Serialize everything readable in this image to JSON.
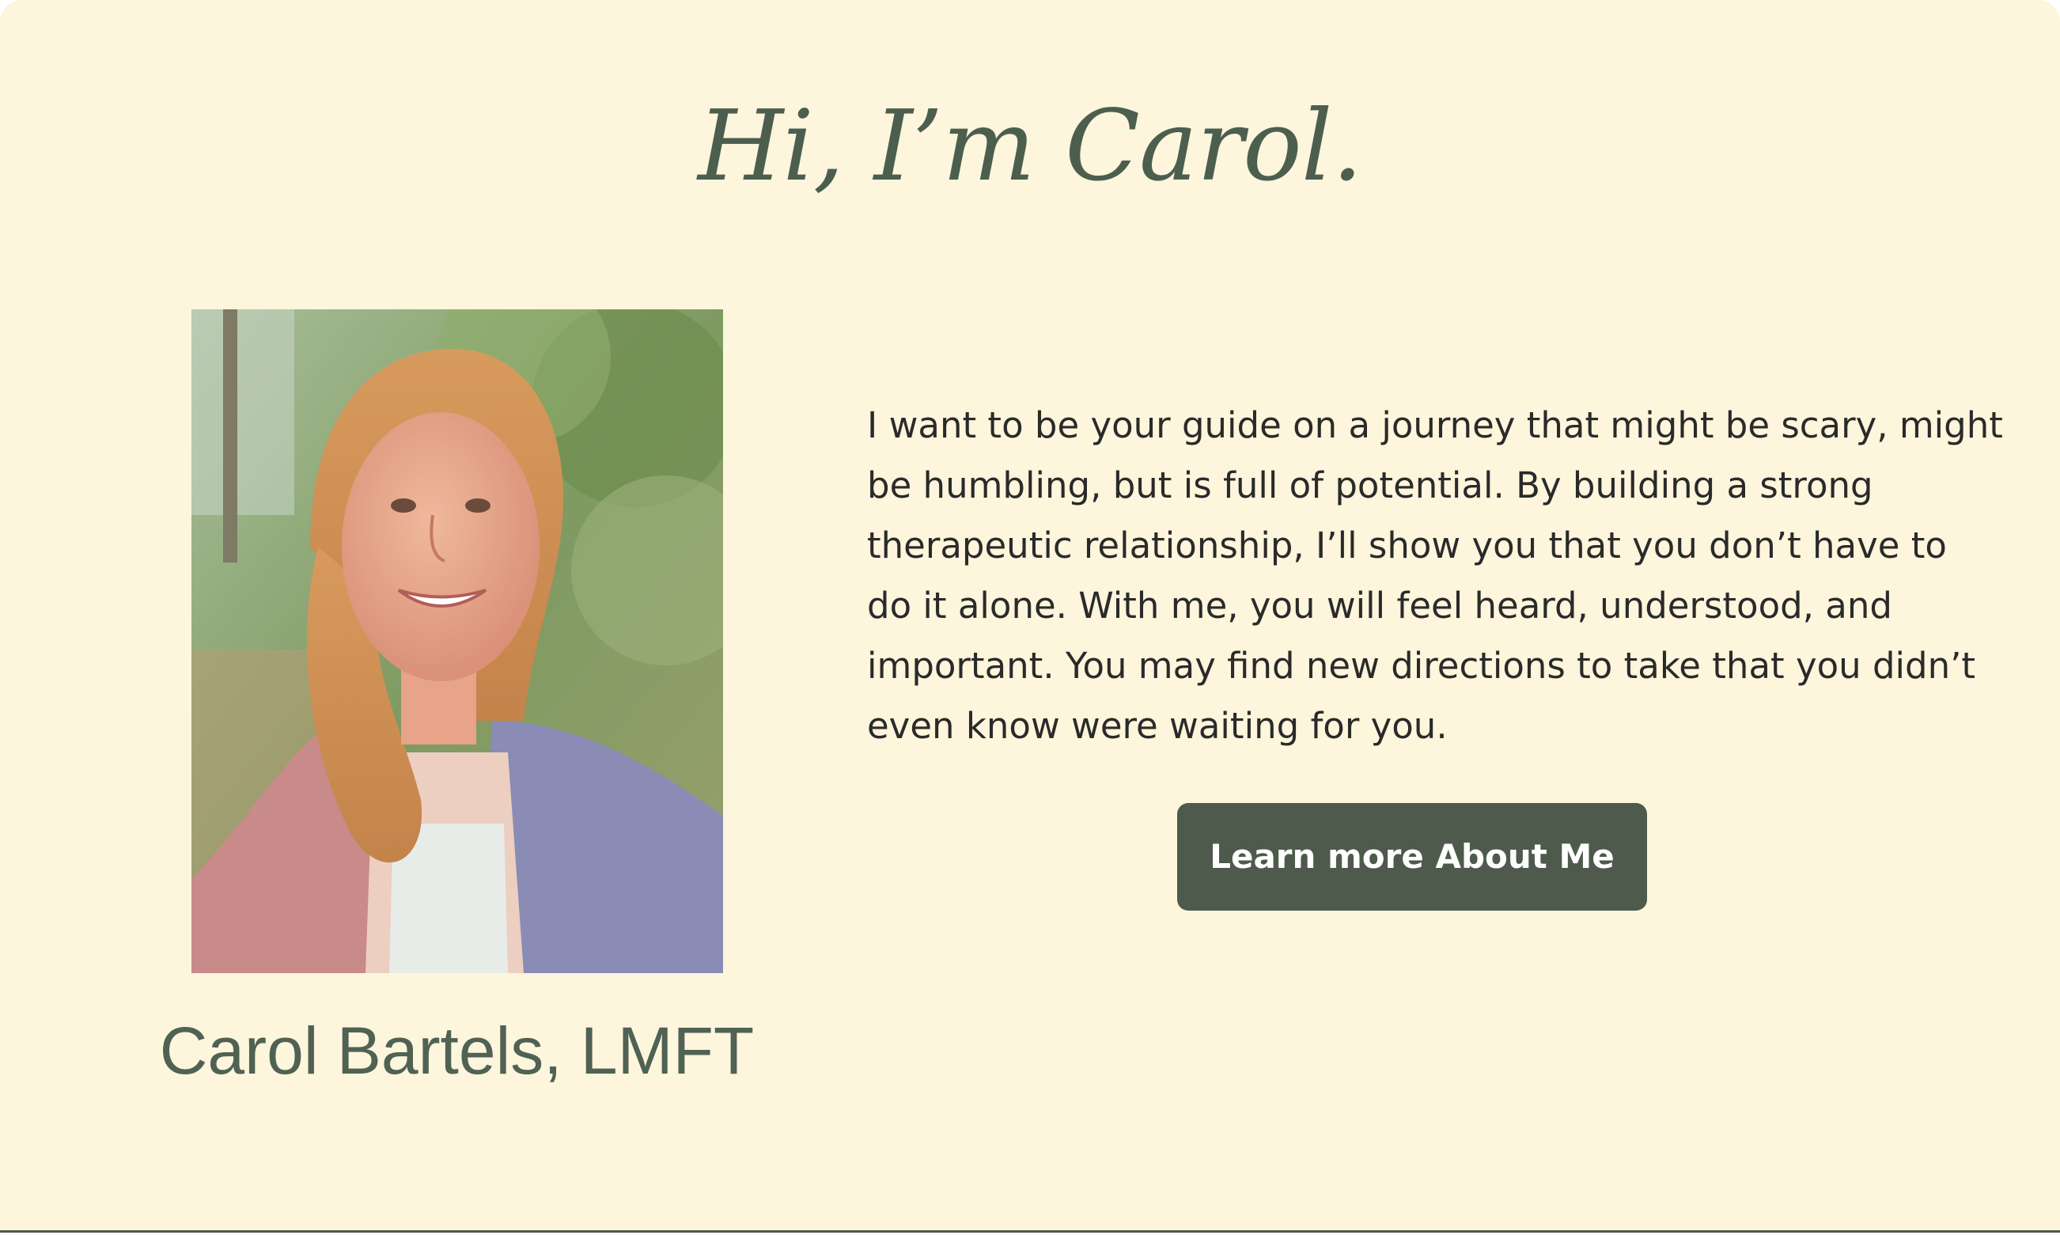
{
  "hero": {
    "heading": "Hi, I’m Carol."
  },
  "profile": {
    "name_caption": "Carol Bartels, LMFT"
  },
  "bio": {
    "lines": [
      "I want to be your guide on a journey that might be scary, might",
      "be humbling, but is full of potential. By building a strong",
      "therapeutic relationship, I’ll show you that you don’t have to",
      "do it alone. With me, you will feel heard, understood, and",
      "important. You may find new directions to take that you didn’t",
      "even know were waiting for you."
    ]
  },
  "cta": {
    "label": "Learn more About Me"
  },
  "colors": {
    "background": "#fdf5dc",
    "accent": "#4d5a4c",
    "heading": "#4c5f4f"
  }
}
